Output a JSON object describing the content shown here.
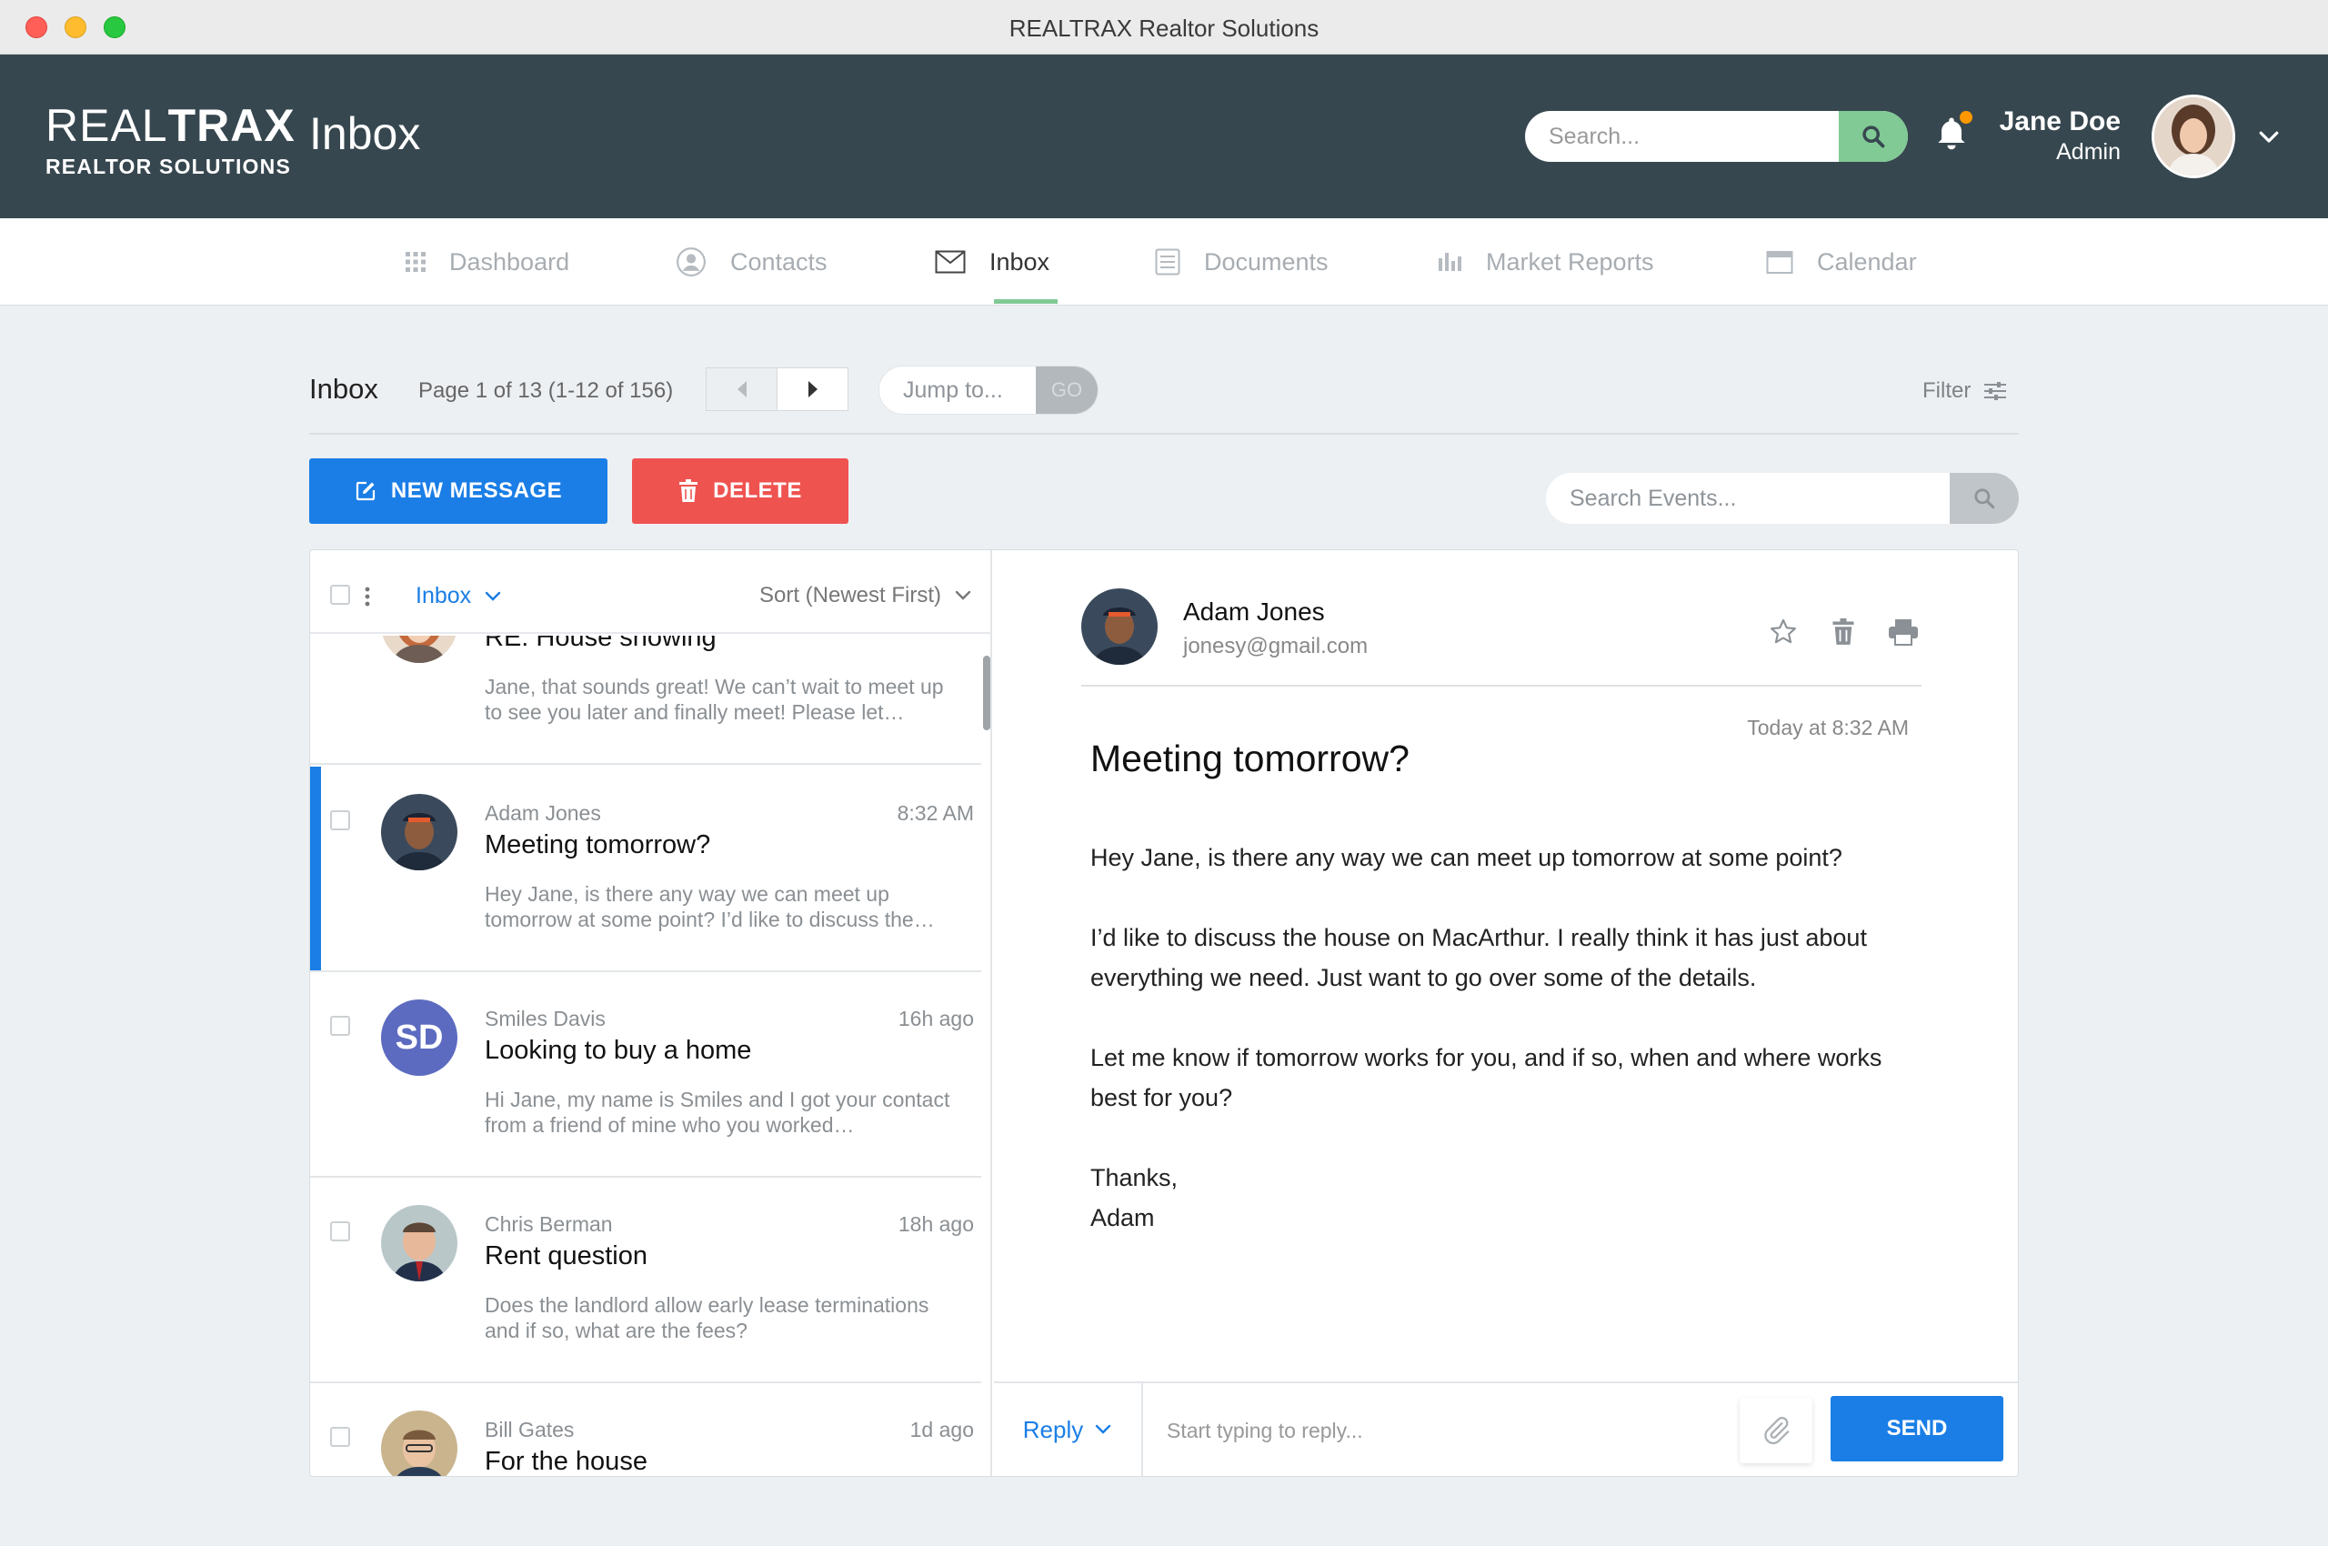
{
  "window": {
    "title": "REALTRAX Realtor Solutions"
  },
  "header": {
    "logo_light": "REAL",
    "logo_bold": "TRAX",
    "logo_sub": "REALTOR SOLUTIONS",
    "title": "Inbox",
    "search_placeholder": "Search...",
    "user": {
      "name": "Jane Doe",
      "role": "Admin"
    }
  },
  "nav": {
    "items": [
      {
        "label": "Dashboard",
        "icon": "grid-icon"
      },
      {
        "label": "Contacts",
        "icon": "user-circle-icon"
      },
      {
        "label": "Inbox",
        "icon": "envelope-icon",
        "active": true
      },
      {
        "label": "Documents",
        "icon": "document-icon"
      },
      {
        "label": "Market Reports",
        "icon": "bar-chart-icon"
      },
      {
        "label": "Calendar",
        "icon": "calendar-icon"
      }
    ]
  },
  "toolbar": {
    "title": "Inbox",
    "page_info": "Page 1 of 13 (1-12 of 156)",
    "jump_placeholder": "Jump to...",
    "go_label": "GO",
    "filter_label": "Filter",
    "new_message_label": "NEW MESSAGE",
    "delete_label": "DELETE",
    "events_placeholder": "Search Events..."
  },
  "list": {
    "folder": "Inbox",
    "sort": "Sort (Newest First)",
    "messages": [
      {
        "sender": "",
        "time": "",
        "subject": "RE: House showing",
        "preview": "Jane, that sounds great! We can’t wait to meet up to see you later and finally meet! Please let…"
      },
      {
        "sender": "Adam Jones",
        "time": "8:32 AM",
        "subject": "Meeting tomorrow?",
        "preview": "Hey Jane, is there any way we can meet up tomorrow at some point? I’d like to discuss the…",
        "selected": true
      },
      {
        "sender": "Smiles Davis",
        "time": "16h ago",
        "subject": "Looking to buy a home",
        "preview": "Hi Jane, my name is Smiles and I got your contact from a friend of mine who you worked…",
        "initials": "SD"
      },
      {
        "sender": "Chris Berman",
        "time": "18h ago",
        "subject": "Rent question",
        "preview": "Does the landlord allow early lease terminations and if so, what are the fees?"
      },
      {
        "sender": "Bill Gates",
        "time": "1d ago",
        "subject": "For the house",
        "preview": ""
      }
    ]
  },
  "reader": {
    "sender_name": "Adam Jones",
    "sender_email": "jonesy@gmail.com",
    "date": "Today at 8:32 AM",
    "subject": "Meeting tomorrow?",
    "body": [
      "Hey Jane, is there any way we can meet up tomorrow at some point?",
      "I’d like to discuss the house on MacArthur. I really think it has just about everything we need. Just want to go over some of the details.",
      "Let me know if tomorrow works for you, and if so, when and where works best for you?"
    ],
    "signoff": "Thanks,",
    "signature": "Adam",
    "reply_type": "Reply",
    "reply_placeholder": "Start typing to reply...",
    "send_label": "SEND"
  },
  "colors": {
    "header_bg": "#37474f",
    "accent_blue": "#1a7ee6",
    "accent_green": "#81c995",
    "delete_red": "#ef5350",
    "notification_dot": "#ff9800"
  }
}
